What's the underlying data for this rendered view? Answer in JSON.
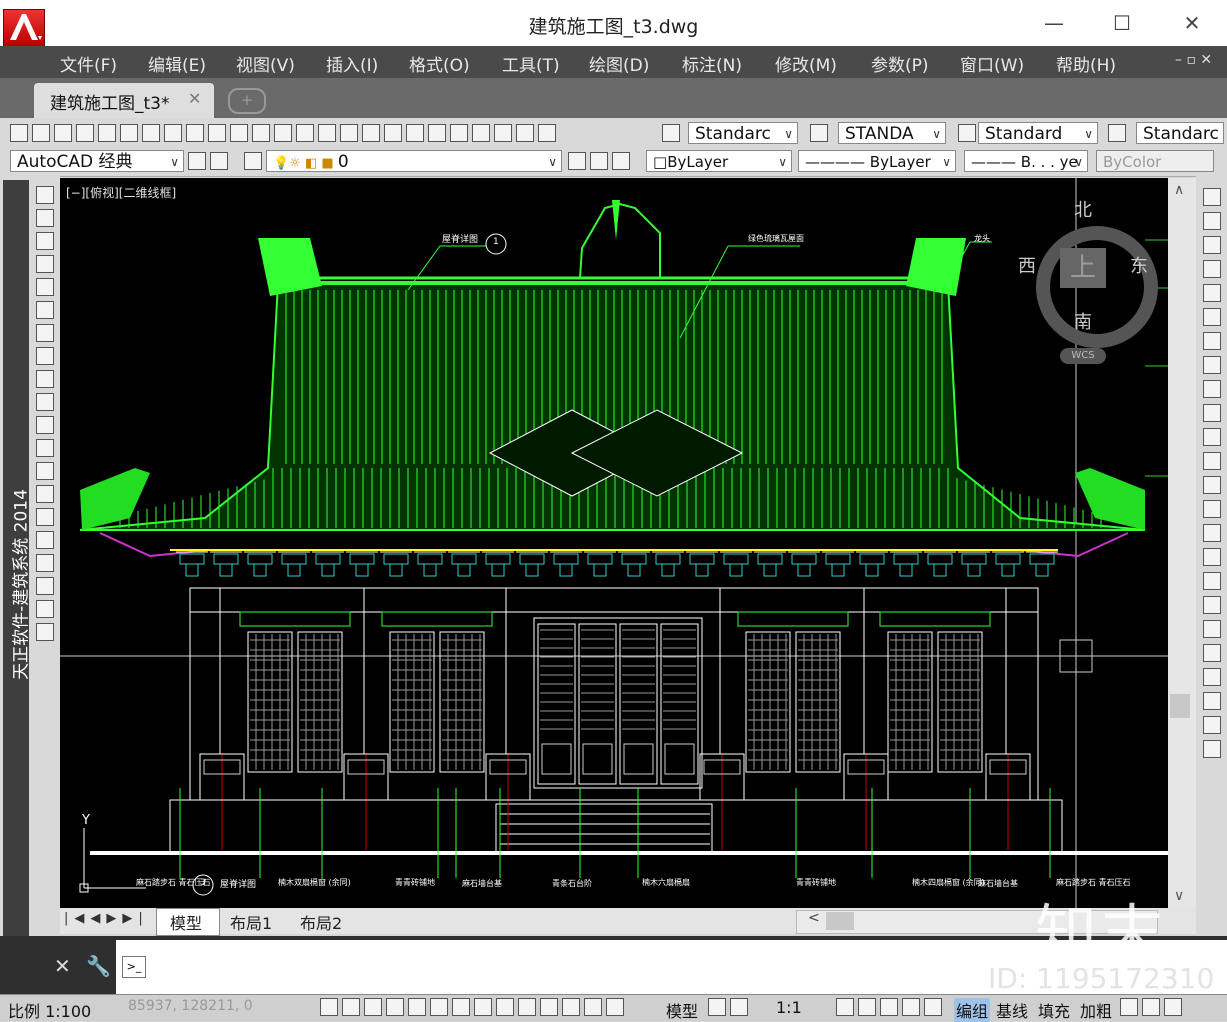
{
  "window": {
    "title": "建筑施工图_t3.dwg",
    "minimize": "—",
    "maximize": "☐",
    "close": "✕"
  },
  "menu": [
    "文件(F)",
    "编辑(E)",
    "视图(V)",
    "插入(I)",
    "格式(O)",
    "工具(T)",
    "绘图(D)",
    "标注(N)",
    "修改(M)",
    "参数(P)",
    "窗口(W)",
    "帮助(H)"
  ],
  "tabs": {
    "document": "建筑施工图_t3*",
    "close": "✕",
    "new": "+"
  },
  "toolbar": {
    "text_style": "Standarc",
    "dim_style": "STANDA",
    "table_style": "Standard",
    "ml_style": "Standarc",
    "workspace": "AutoCAD 经典",
    "layer": "0",
    "color": "ByLayer",
    "linetype": "ByLayer",
    "lineweight": "B. . . ye",
    "plotstyle": "ByColor"
  },
  "left_strip_label": "天正软件-建筑系统 2014",
  "viewport": {
    "label": "[−][俯视][二维线框]"
  },
  "viewcube": {
    "north": "北",
    "south": "南",
    "east": "东",
    "west": "西",
    "top": "上",
    "wcs": "WCS"
  },
  "drawing": {
    "callouts_top": [
      "屋脊详图",
      "绿色琉璃瓦屋面",
      "龙头"
    ],
    "callout_number_top": "1",
    "callout_number_bottom": "3",
    "bottom_labels": [
      "麻石踏步石 青石压石",
      "屋脊详图",
      "楠木双扇槅窗 (余同)",
      "青青砖铺地",
      "麻石墙台基",
      "青条石台阶",
      "楠木六扇槅扇",
      "青青砖铺地",
      "楠木四扇槅窗 (余同)",
      "麻石墙台基",
      "麻石踏步石 青石压石"
    ],
    "axis_y": "Y"
  },
  "layout_tabs": {
    "model": "模型",
    "layout1": "布局1",
    "layout2": "布局2"
  },
  "status": {
    "scale": "比例 1:100",
    "coords": "85937, 128211, 0",
    "model": "模型",
    "annoscale": "1:1",
    "group": "编组",
    "baseline": "基线",
    "fill": "填充",
    "bold": "加粗"
  },
  "watermark": {
    "brand": "知末",
    "id": "ID: 1195172310"
  },
  "colors": {
    "roof": "#33ff33",
    "bracket": "#33cccc",
    "column_line": "#cc0000",
    "eave": "#ffff00",
    "purple": "#cc33cc"
  }
}
